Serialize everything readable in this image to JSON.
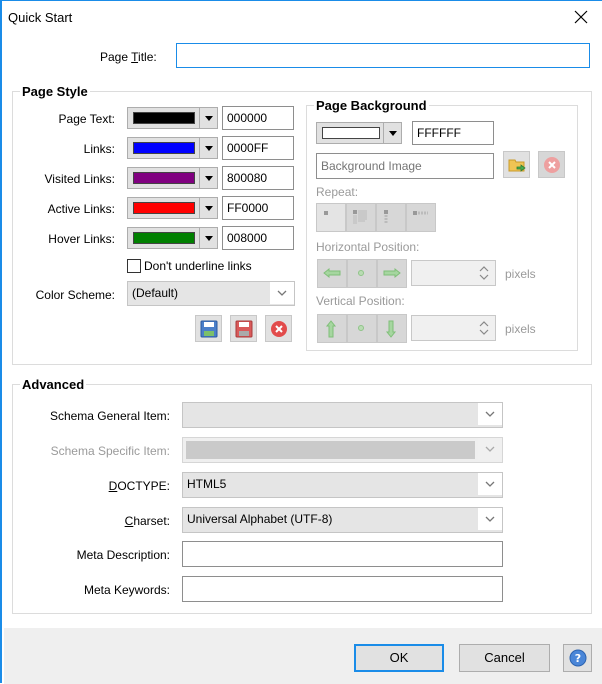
{
  "window": {
    "title": "Quick Start",
    "close_icon": "close-icon"
  },
  "page_title": {
    "label_prefix": "Page ",
    "label_mnemonic": "T",
    "label_suffix": "itle:",
    "value": ""
  },
  "page_style": {
    "title": "Page Style",
    "colors": [
      {
        "label": "Page Text:",
        "hex": "000000",
        "swatch": "#000000"
      },
      {
        "label": "Links:",
        "hex": "0000FF",
        "swatch": "#0000FF"
      },
      {
        "label": "Visited Links:",
        "hex": "800080",
        "swatch": "#800080"
      },
      {
        "label": "Active Links:",
        "hex": "FF0000",
        "swatch": "#FF0000"
      },
      {
        "label": "Hover Links:",
        "hex": "008000",
        "swatch": "#008000"
      }
    ],
    "dont_underline_label": "Don't underline links",
    "dont_underline_checked": false,
    "color_scheme_label": "Color Scheme:",
    "color_scheme_value": "(Default)",
    "scheme_buttons": [
      "save-scheme-icon",
      "save-as-scheme-icon",
      "delete-scheme-icon"
    ]
  },
  "page_background": {
    "title": "Page Background",
    "color_hex": "FFFFFF",
    "color_swatch": "#FFFFFF",
    "image_placeholder": "Background Image",
    "image_value": "",
    "repeat_label": "Repeat:",
    "repeat_options": [
      "no-repeat",
      "repeat",
      "repeat-y",
      "repeat-x"
    ],
    "horizontal_label": "Horizontal Position:",
    "vertical_label": "Vertical Position:",
    "horizontal_value": "",
    "vertical_value": "",
    "units": "pixels"
  },
  "advanced": {
    "title": "Advanced",
    "schema_general_label": "Schema General Item:",
    "schema_general_value": "",
    "schema_specific_label": "Schema Specific Item:",
    "schema_specific_value": "",
    "doctype_mnemonic": "D",
    "doctype_rest": "OCTYPE:",
    "doctype_value": "HTML5",
    "charset_mnemonic": "C",
    "charset_rest": "harset:",
    "charset_value": "Universal Alphabet (UTF-8)",
    "meta_description_label": "Meta Description:",
    "meta_description_value": "",
    "meta_keywords_label": "Meta Keywords:",
    "meta_keywords_value": ""
  },
  "footer": {
    "ok_label": "OK",
    "cancel_label": "Cancel",
    "help_icon": "help-icon"
  }
}
